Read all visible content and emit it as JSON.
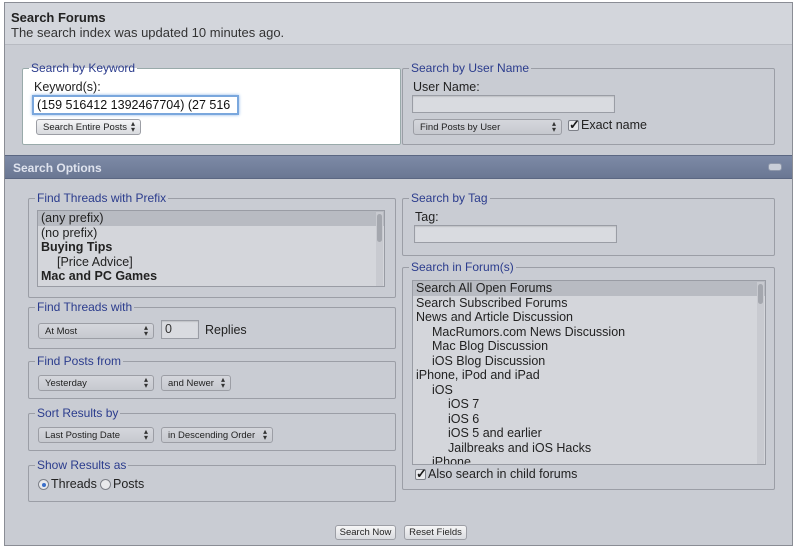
{
  "header": {
    "title": "Search Forums",
    "subtitle": "The search index was updated 10 minutes ago."
  },
  "keyword": {
    "legend": "Search by Keyword",
    "label": "Keyword(s):",
    "value": "(159 516412 1392467704) (27 516",
    "mode_select": "Search Entire Posts"
  },
  "username": {
    "legend": "Search by User Name",
    "label": "User Name:",
    "value": "",
    "mode_select": "Find Posts by User",
    "exact_label": "Exact name",
    "exact_checked": true
  },
  "options_bar": {
    "title": "Search Options"
  },
  "prefix": {
    "legend": "Find Threads with Prefix",
    "items": [
      {
        "label": "(any prefix)",
        "selected": true,
        "bold": false,
        "indent": 0
      },
      {
        "label": "(no prefix)",
        "selected": false,
        "bold": false,
        "indent": 0
      },
      {
        "label": "Buying Tips",
        "selected": false,
        "bold": true,
        "indent": 0
      },
      {
        "label": "[Price Advice]",
        "selected": false,
        "bold": false,
        "indent": 1
      },
      {
        "label": "Mac and PC Games",
        "selected": false,
        "bold": true,
        "indent": 0
      }
    ]
  },
  "threads_with": {
    "legend": "Find Threads with",
    "select": "At Most",
    "value": "0",
    "unit": "Replies"
  },
  "posts_from": {
    "legend": "Find Posts from",
    "select": "Yesterday",
    "direction": "and Newer"
  },
  "sort": {
    "legend": "Sort Results by",
    "field": "Last Posting Date",
    "order": "in Descending Order"
  },
  "show_as": {
    "legend": "Show Results as",
    "threads": "Threads",
    "posts": "Posts",
    "selected": "Threads"
  },
  "tag": {
    "legend": "Search by Tag",
    "label": "Tag:",
    "value": ""
  },
  "forums": {
    "legend": "Search in Forum(s)",
    "items": [
      {
        "label": "Search All Open Forums",
        "selected": true,
        "indent": 0
      },
      {
        "label": "Search Subscribed Forums",
        "selected": false,
        "indent": 0
      },
      {
        "label": "News and Article Discussion",
        "selected": false,
        "indent": 0
      },
      {
        "label": "MacRumors.com News Discussion",
        "selected": false,
        "indent": 1
      },
      {
        "label": "Mac Blog Discussion",
        "selected": false,
        "indent": 1
      },
      {
        "label": "iOS Blog Discussion",
        "selected": false,
        "indent": 1
      },
      {
        "label": "iPhone, iPod and iPad",
        "selected": false,
        "indent": 0
      },
      {
        "label": "iOS",
        "selected": false,
        "indent": 1
      },
      {
        "label": "iOS 7",
        "selected": false,
        "indent": 2
      },
      {
        "label": "iOS 6",
        "selected": false,
        "indent": 2
      },
      {
        "label": "iOS 5 and earlier",
        "selected": false,
        "indent": 2
      },
      {
        "label": "Jailbreaks and iOS Hacks",
        "selected": false,
        "indent": 2
      },
      {
        "label": "iPhone",
        "selected": false,
        "indent": 1
      }
    ],
    "child_label": "Also search in child forums",
    "child_checked": true
  },
  "actions": {
    "search": "Search Now",
    "reset": "Reset Fields"
  }
}
